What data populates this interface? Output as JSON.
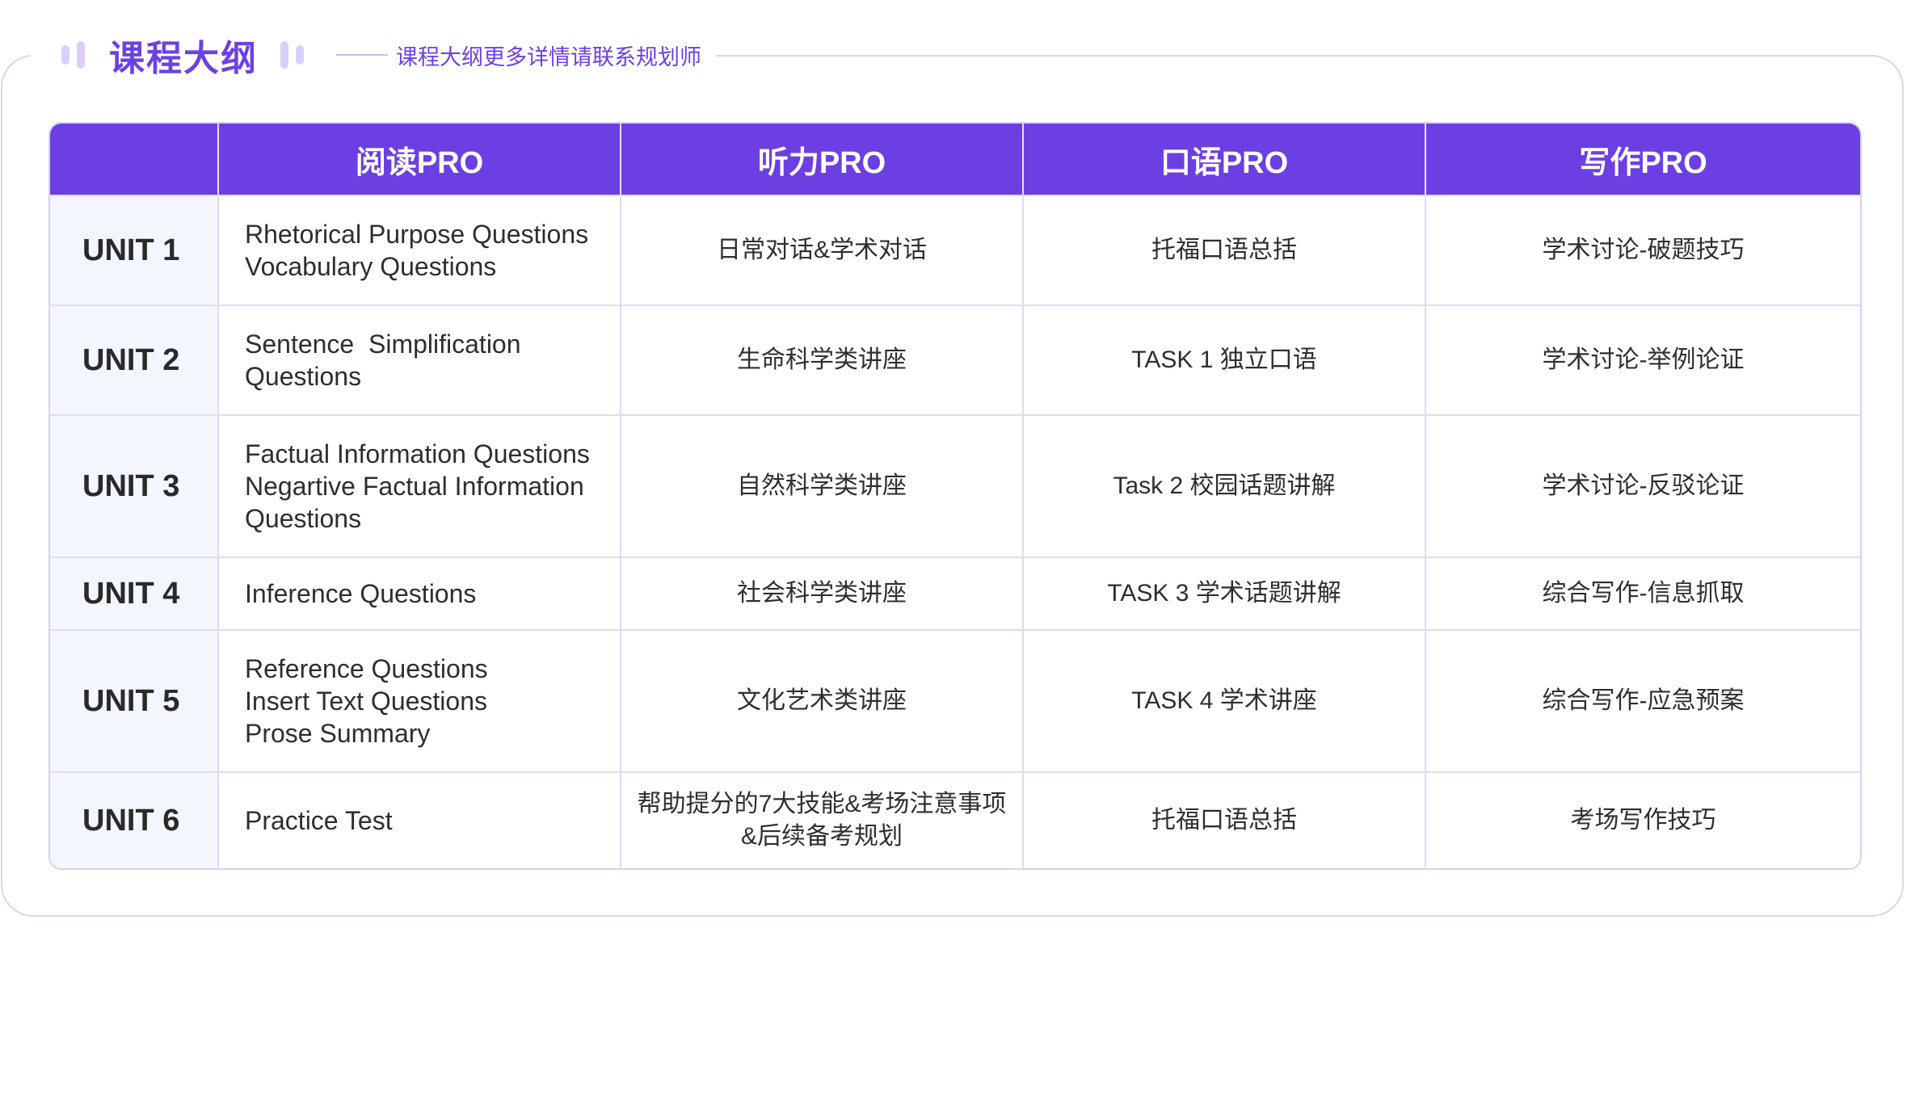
{
  "header": {
    "title": "课程大纲",
    "subtitle": "课程大纲更多详情请联系规划师"
  },
  "colors": {
    "accent": "#6c3fe2",
    "border": "#d9d3f7",
    "unit_bg": "#f4f6fd"
  },
  "table": {
    "columns": [
      "",
      "阅读PRO",
      "听力PRO",
      "口语PRO",
      "写作PRO"
    ],
    "rows": [
      {
        "unit": "UNIT 1",
        "reading": [
          "Rhetorical Purpose Questions",
          "Vocabulary Questions"
        ],
        "listening": [
          "日常对话&学术对话"
        ],
        "speaking": [
          "托福口语总括"
        ],
        "writing": [
          "学术讨论-破题技巧"
        ]
      },
      {
        "unit": "UNIT 2",
        "reading": [
          "Sentence  Simplification",
          "Questions"
        ],
        "listening": [
          "生命科学类讲座"
        ],
        "speaking": [
          "TASK 1 独立口语"
        ],
        "writing": [
          "学术讨论-举例论证"
        ]
      },
      {
        "unit": "UNIT 3",
        "reading": [
          "Factual Information Questions",
          "Negartive Factual Information",
          "Questions"
        ],
        "listening": [
          "自然科学类讲座"
        ],
        "speaking": [
          "Task 2 校园话题讲解"
        ],
        "writing": [
          "学术讨论-反驳论证"
        ]
      },
      {
        "unit": "UNIT 4",
        "reading": [
          "Inference Questions"
        ],
        "listening": [
          "社会科学类讲座"
        ],
        "speaking": [
          "TASK 3 学术话题讲解"
        ],
        "writing": [
          "综合写作-信息抓取"
        ]
      },
      {
        "unit": "UNIT 5",
        "reading": [
          "Reference Questions",
          "Insert Text Questions",
          "Prose Summary"
        ],
        "listening": [
          "文化艺术类讲座"
        ],
        "speaking": [
          "TASK 4 学术讲座"
        ],
        "writing": [
          "综合写作-应急预案"
        ]
      },
      {
        "unit": "UNIT 6",
        "reading": [
          "Practice Test"
        ],
        "listening": [
          "帮助提分的7大技能&考场注意事项",
          "&后续备考规划"
        ],
        "speaking": [
          "托福口语总括"
        ],
        "writing": [
          "考场写作技巧"
        ]
      }
    ]
  }
}
